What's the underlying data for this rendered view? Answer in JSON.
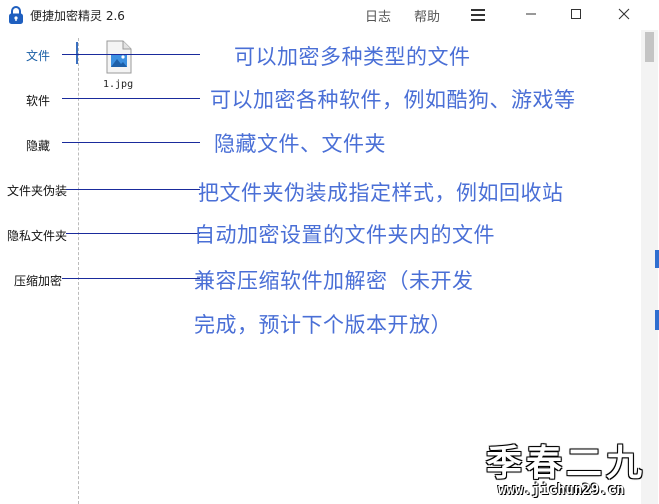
{
  "titlebar": {
    "title": "便捷加密精灵 2.6",
    "menu": {
      "diary": "日志",
      "help": "帮助"
    }
  },
  "sidebar": {
    "items": [
      {
        "label": "文件",
        "active": true
      },
      {
        "label": "软件",
        "active": false
      },
      {
        "label": "隐藏",
        "active": false
      },
      {
        "label": "文件夹伪装",
        "active": false
      },
      {
        "label": "隐私文件夹",
        "active": false
      },
      {
        "label": "压缩加密",
        "active": false
      }
    ]
  },
  "files": [
    {
      "name": "1.jpg",
      "icon": "image-file-icon"
    }
  ],
  "annotations": [
    "可以加密多种类型的文件",
    "可以加密各种软件，例如酷狗、游戏等",
    "隐藏文件、文件夹",
    "把文件夹伪装成指定样式，例如回收站",
    "自动加密设置的文件夹内的文件",
    "兼容压缩软件加解密（未开发",
    "完成，预计下个版本开放）"
  ],
  "watermark": {
    "text": "季春二九",
    "url": "www.jichun29.cn"
  },
  "colors": {
    "annotation_text": "#4a6fd6",
    "annotation_line": "#1a2b9c",
    "active_item": "#1a5fa6",
    "edge_accent": "#2f6fd0"
  }
}
